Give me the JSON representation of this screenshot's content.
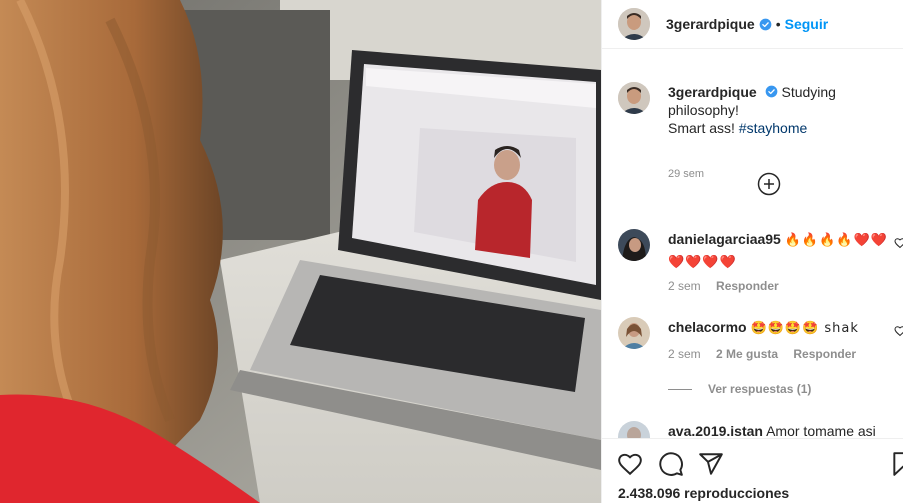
{
  "post": {
    "author": "3gerardpique",
    "follow_label": "Seguir",
    "separator": "•",
    "caption_line1": "Studying philosophy!",
    "caption_line2_plain": "Smart ass! ",
    "caption_hashtag": "#stayhome",
    "caption_time": "29 sem",
    "views": "2.438.096 reproducciones"
  },
  "comments": [
    {
      "user": "danielagarciaa95",
      "text_line1": "🔥🔥🔥🔥❤️❤️",
      "text_line2": "❤️❤️❤️❤️",
      "time": "2 sem",
      "reply_label": "Responder"
    },
    {
      "user": "chelacormo",
      "text": "🤩🤩🤩🤩 shak",
      "time": "2 sem",
      "likes": "2 Me gusta",
      "reply_label": "Responder",
      "view_replies": "Ver respuestas (1)"
    },
    {
      "user": "ava.2019.istan",
      "text": "Amor tomame asi"
    }
  ],
  "colors": {
    "accent": "#0095f6",
    "hashtag": "#00376b",
    "muted": "#8e8e8e"
  },
  "icons": [
    "verified-badge-icon",
    "add-comment-icon",
    "heart-icon",
    "comment-icon",
    "share-icon",
    "save-icon"
  ]
}
